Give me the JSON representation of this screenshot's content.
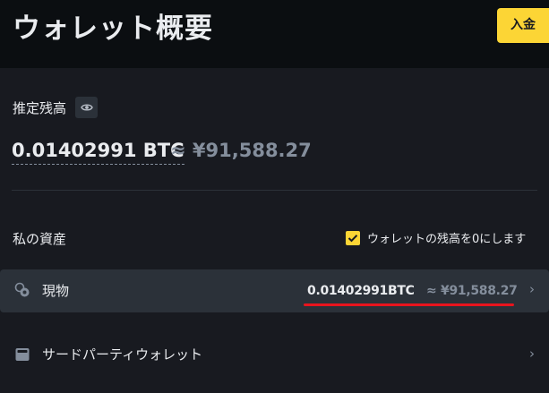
{
  "header": {
    "title": "ウォレット概要",
    "deposit_label": "入金"
  },
  "balance": {
    "label": "推定残高",
    "btc": "0.01402991 BTC",
    "fiat": "≈ ¥91,588.27"
  },
  "assets": {
    "label": "私の資産",
    "hide_zero_label": "ウォレットの残高を0にします",
    "hide_zero_checked": true
  },
  "rows": [
    {
      "label": "現物",
      "icon": "coins-icon",
      "btc": "0.01402991BTC",
      "fiat": "≈ ¥91,588.27",
      "chevron": "›"
    },
    {
      "label": "サードパーティウォレット",
      "icon": "wallet-icon",
      "chevron": "›"
    }
  ],
  "colors": {
    "background": "#181a20",
    "header_background": "#0b0e11",
    "accent": "#fcd535",
    "row_highlight": "#2b3139",
    "muted_text": "#848e9c",
    "annotation_underline": "#e8141d"
  }
}
